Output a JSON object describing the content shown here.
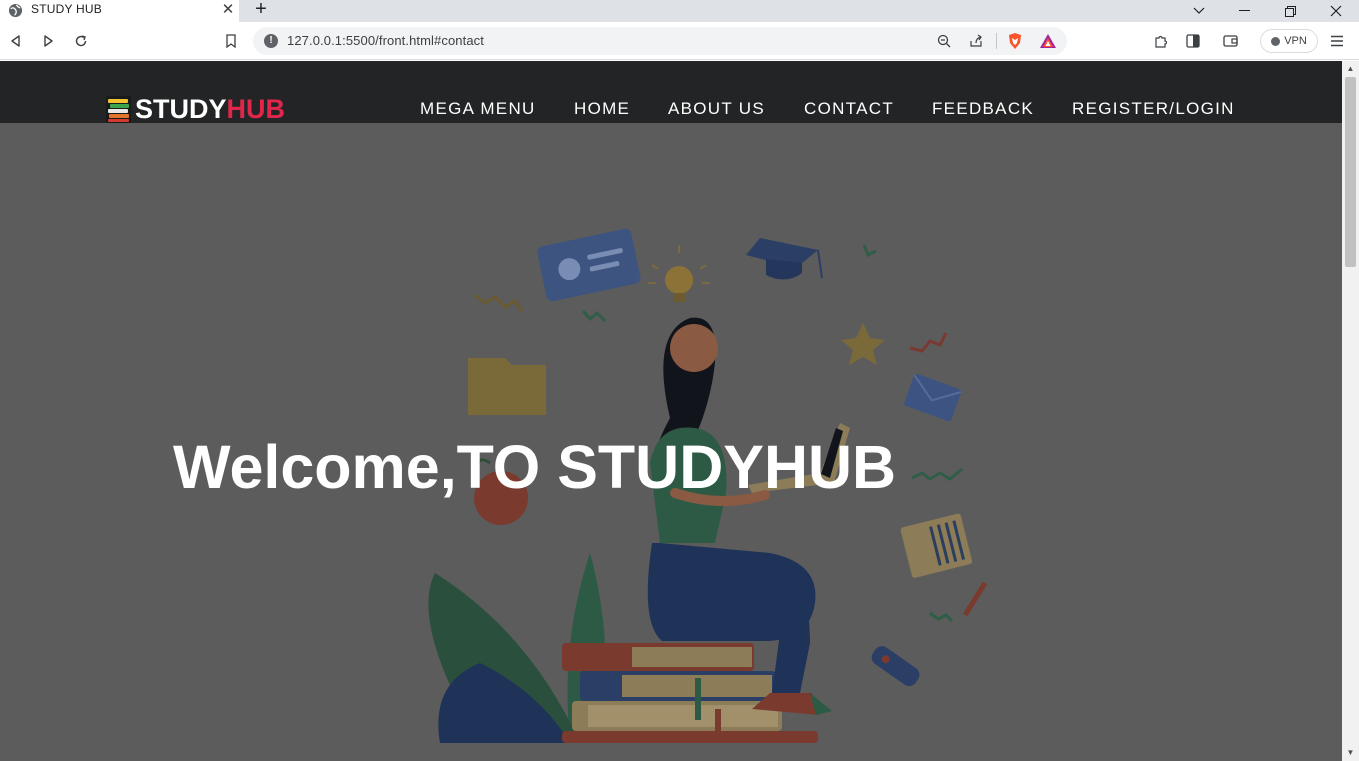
{
  "browser": {
    "tab_title": "STUDY HUB",
    "url": "127.0.0.1:5500/front.html#contact",
    "vpn_label": "VPN",
    "icons": [
      "globe-icon",
      "close-icon",
      "plus-icon",
      "chevron-down-icon",
      "minimize-icon",
      "restore-icon",
      "close-window-icon",
      "back-icon",
      "forward-icon",
      "reload-icon",
      "bookmark-icon",
      "info-icon",
      "zoom-out-icon",
      "share-icon",
      "brave-shields-icon",
      "brave-rewards-icon",
      "extensions-icon",
      "sidebar-icon",
      "wallet-icon",
      "menu-icon"
    ]
  },
  "site": {
    "logo_primary": "STUDY",
    "logo_accent": "HUB",
    "accent_color": "#e0264a",
    "nav": [
      {
        "label": "MEGA MENU"
      },
      {
        "label": "HOME"
      },
      {
        "label": "ABOUT US"
      },
      {
        "label": "CONTACT"
      },
      {
        "label": "FEEDBACK"
      },
      {
        "label": "REGISTER/LOGIN"
      }
    ],
    "hero_title": "Welcome,TO STUDYHUB"
  }
}
